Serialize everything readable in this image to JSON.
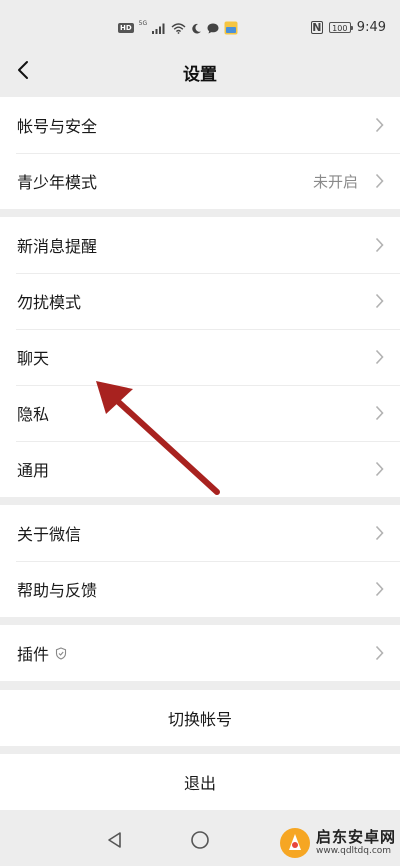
{
  "status_bar": {
    "time": "9:49",
    "battery": "100",
    "hd_label": "HD",
    "signal_label": "5G"
  },
  "nav": {
    "title": "设置"
  },
  "groups": [
    {
      "items": [
        {
          "label": "帐号与安全",
          "value": ""
        },
        {
          "label": "青少年模式",
          "value": "未开启"
        }
      ]
    },
    {
      "items": [
        {
          "label": "新消息提醒",
          "value": ""
        },
        {
          "label": "勿扰模式",
          "value": ""
        },
        {
          "label": "聊天",
          "value": ""
        },
        {
          "label": "隐私",
          "value": ""
        },
        {
          "label": "通用",
          "value": ""
        }
      ]
    },
    {
      "items": [
        {
          "label": "关于微信",
          "value": ""
        },
        {
          "label": "帮助与反馈",
          "value": ""
        }
      ]
    },
    {
      "items": [
        {
          "label": "插件",
          "value": ""
        }
      ]
    }
  ],
  "actions": {
    "switch_account": "切换帐号",
    "logout": "退出"
  },
  "watermark": {
    "title": "启东安卓网",
    "url": "www.qdltdq.com"
  },
  "colors": {
    "background": "#ededed",
    "annotation_arrow": "#b22222"
  }
}
